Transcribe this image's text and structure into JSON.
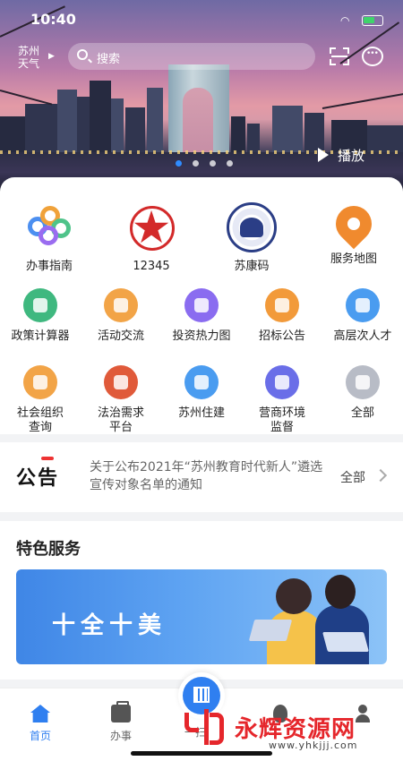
{
  "status_bar": {
    "time": "10:40"
  },
  "header": {
    "weather_city": "苏州",
    "weather_label": "天气",
    "search_placeholder": "搜索",
    "banner_dots": 4,
    "play_label": "播放"
  },
  "primary_services": [
    {
      "label": "办事指南",
      "icon": "service-guide-icon"
    },
    {
      "label": "12345",
      "icon": "hotline-star-icon"
    },
    {
      "label": "苏康码",
      "icon": "health-code-seal-icon"
    },
    {
      "label": "服务地图",
      "icon": "map-pin-icon"
    }
  ],
  "services_row1": [
    {
      "label": "政策计算器",
      "icon": "calculator-icon",
      "color": "#3fb87f"
    },
    {
      "label": "活动交流",
      "icon": "chat-icon",
      "color": "#f2a447"
    },
    {
      "label": "投资热力图",
      "icon": "heatmap-icon",
      "color": "#8a6cf0"
    },
    {
      "label": "招标公告",
      "icon": "gavel-icon",
      "color": "#f29a3a"
    },
    {
      "label": "高层次人才",
      "icon": "graduation-cap-icon",
      "color": "#4a9cf0"
    }
  ],
  "services_row2": [
    {
      "label": "社会组织\n查询",
      "icon": "org-search-icon",
      "color": "#f2a447"
    },
    {
      "label": "法治需求\n平台",
      "icon": "law-platform-icon",
      "color": "#e05a3a"
    },
    {
      "label": "苏州住建",
      "icon": "housing-icon",
      "color": "#4a9cf0"
    },
    {
      "label": "营商环境\n监督",
      "icon": "police-cap-icon",
      "color": "#6a6ee8"
    },
    {
      "label": "全部",
      "icon": "grid-all-icon",
      "color": "#b8bcc6"
    }
  ],
  "notice": {
    "title": "公告",
    "text": "关于公布2021年“苏州教育时代新人”遴选宣传对象名单的通知",
    "all_label": "全部"
  },
  "feature": {
    "heading": "特色服务",
    "banner_text": "十全十美"
  },
  "tabbar": {
    "home": "首页",
    "affairs": "办事",
    "scan": "一扫",
    "watermark_title": "永辉资源网",
    "watermark_url": "www.yhkjjj.com"
  },
  "colors": {
    "accent": "#2f7ff0",
    "notice_red": "#e33333"
  }
}
